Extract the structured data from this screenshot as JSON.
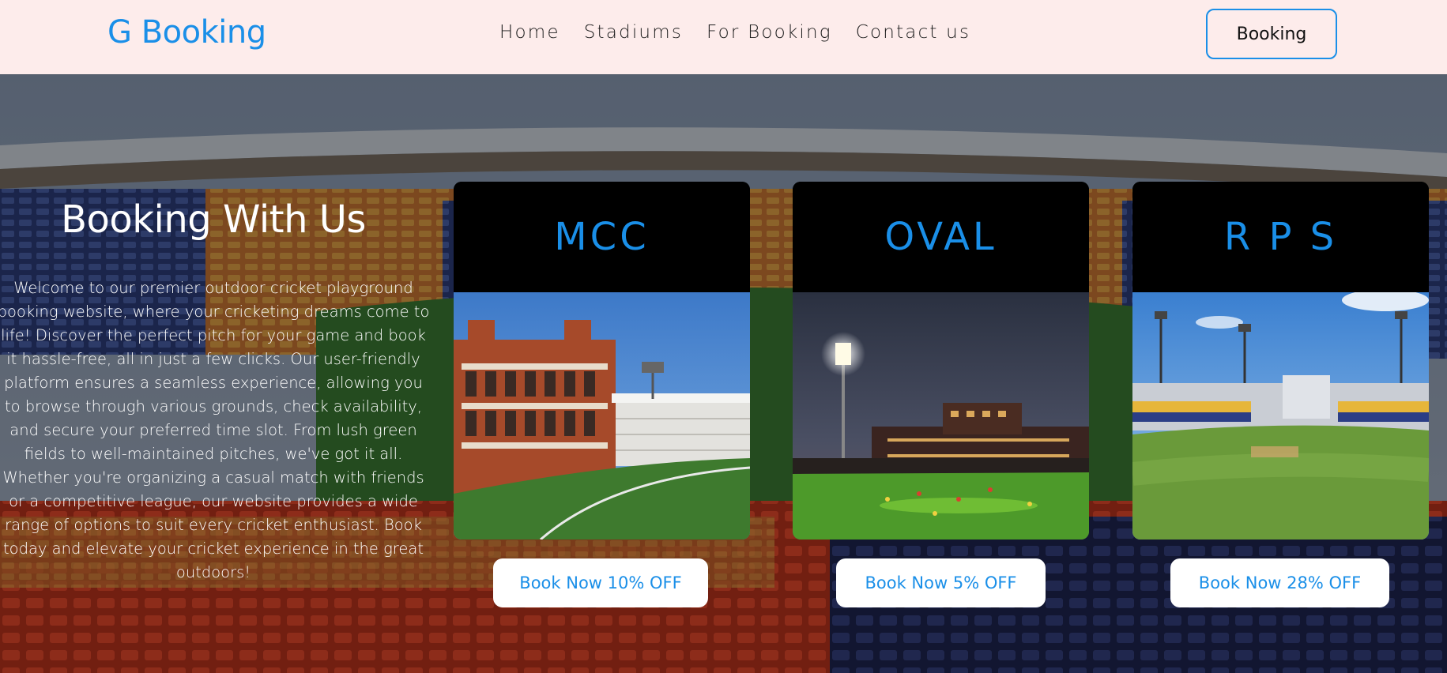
{
  "header": {
    "logo": "G Booking",
    "nav": [
      "Home",
      "Stadiums",
      "For Booking",
      "Contact us"
    ],
    "cta_label": "Booking",
    "background": "#fdeceb",
    "accent": "#1a8fe8"
  },
  "intro": {
    "title": "Booking With Us",
    "body": "Welcome to our premier outdoor cricket playground booking website, where your cricketing dreams come to life! Discover the perfect pitch for your game and book it hassle-free, all in just a few clicks. Our user-friendly platform ensures a seamless experience, allowing you to browse through various grounds, check availability, and secure your preferred time slot. From lush green fields to well-maintained pitches, we've got it all. Whether you're organizing a casual match with friends or a competitive league, our website provides a wide range of options to suit every cricket enthusiast. Book today and elevate your cricket experience in the great outdoors!"
  },
  "stadiums": [
    {
      "name": "MCC",
      "button": "Book Now 10% OFF",
      "image": "lords-pavilion-image"
    },
    {
      "name": "OVAL",
      "button": "Book Now 5% OFF",
      "image": "oval-night-image"
    },
    {
      "name": "R P S",
      "button": "Book Now 28% OFF",
      "image": "rps-ground-image"
    }
  ]
}
